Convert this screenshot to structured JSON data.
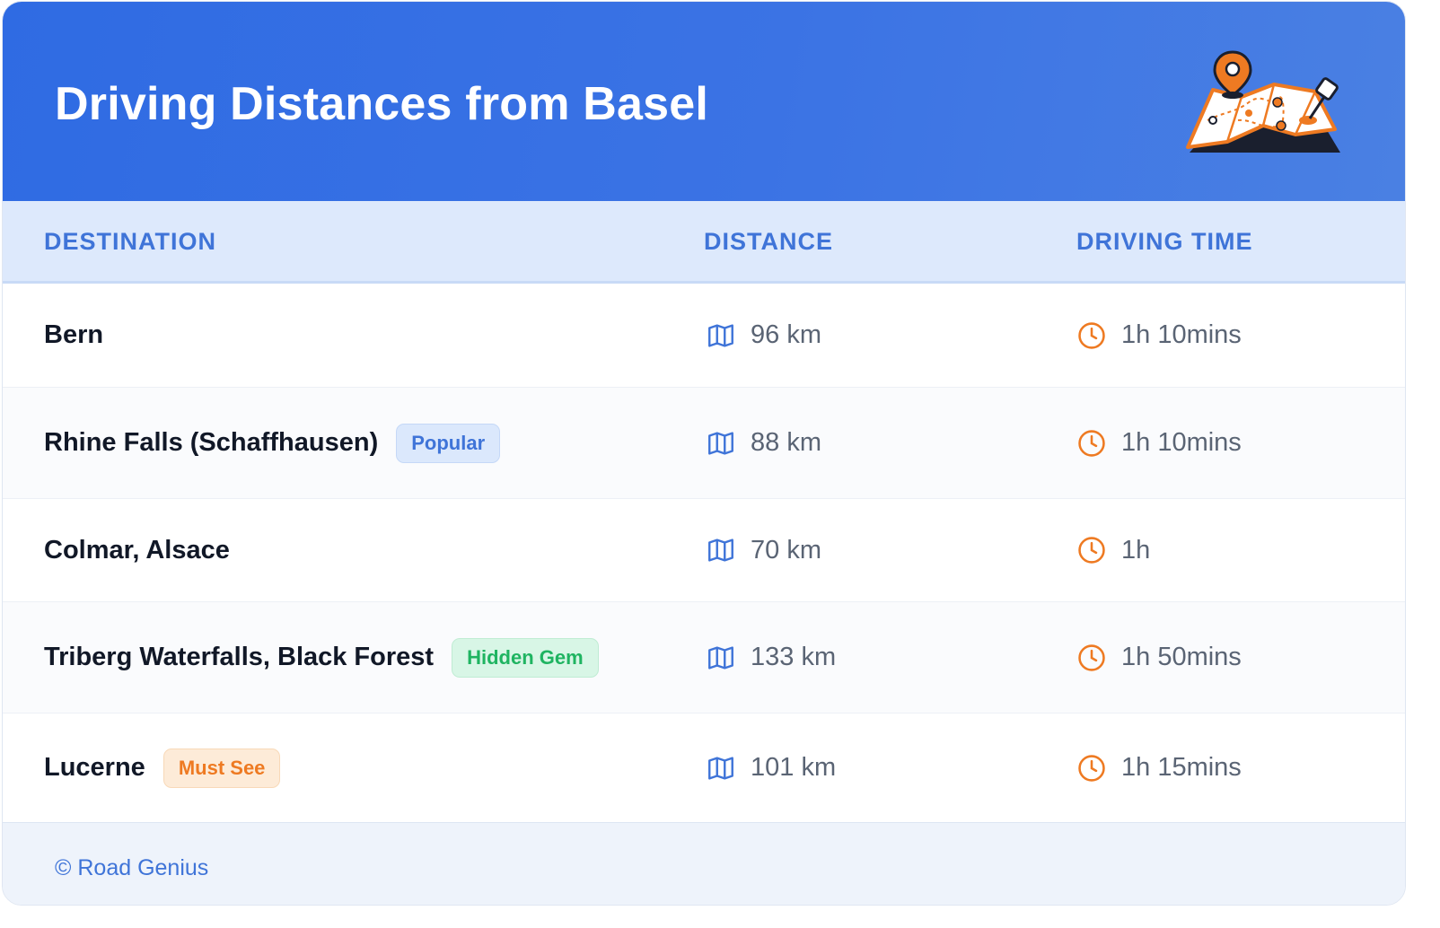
{
  "header": {
    "title": "Driving Distances from Basel",
    "illustration_icon": "map-with-pin-icon"
  },
  "table": {
    "columns": [
      "DESTINATION",
      "DISTANCE",
      "DRIVING TIME"
    ],
    "rows": [
      {
        "destination": "Bern",
        "badge": "",
        "badge_type": "",
        "distance": "96 km",
        "time": "1h 10mins"
      },
      {
        "destination": "Rhine Falls (Schaffhausen)",
        "badge": "Popular",
        "badge_type": "popular",
        "distance": "88 km",
        "time": "1h 10mins"
      },
      {
        "destination": "Colmar, Alsace",
        "badge": "",
        "badge_type": "",
        "distance": "70 km",
        "time": "1h"
      },
      {
        "destination": "Triberg Waterfalls, Black Forest",
        "badge": "Hidden Gem",
        "badge_type": "hidden",
        "distance": "133 km",
        "time": "1h 50mins"
      },
      {
        "destination": "Lucerne",
        "badge": "Must See",
        "badge_type": "must",
        "distance": "101 km",
        "time": "1h 15mins"
      }
    ],
    "distance_icon": "map-icon",
    "time_icon": "clock-icon"
  },
  "footer": {
    "copyright": "© Road Genius"
  },
  "colors": {
    "header_gradient_start": "#2f6be3",
    "header_gradient_end": "#4a80e3",
    "accent_blue": "#3f74d8",
    "accent_orange": "#ee7a22",
    "accent_green": "#1fb461"
  }
}
